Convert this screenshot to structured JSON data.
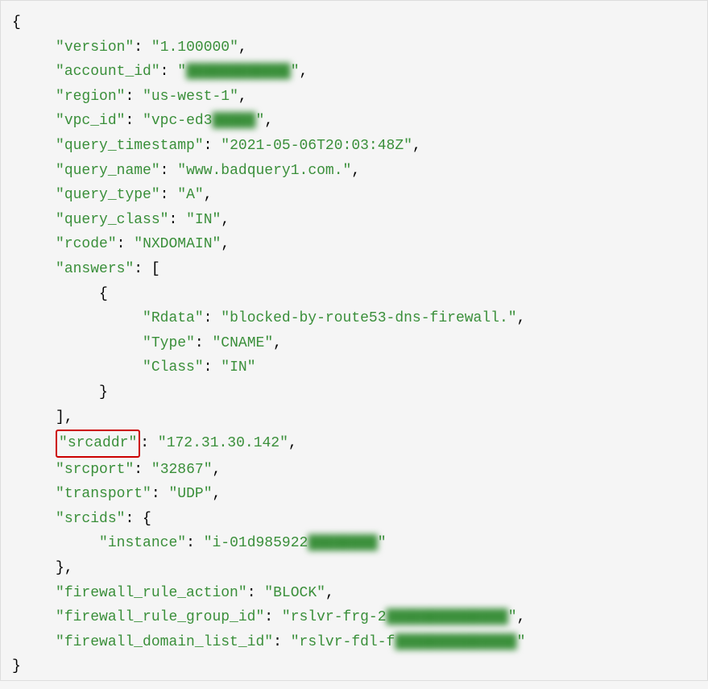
{
  "json_data": {
    "version": "1.100000",
    "account_id_prefix": "",
    "account_id_blurred": "████████████",
    "region": "us-west-1",
    "vpc_id_prefix": "vpc-ed3",
    "vpc_id_blurred": "█████",
    "query_timestamp": "2021-05-06T20:03:48Z",
    "query_name": "www.badquery1.com.",
    "query_type": "A",
    "query_class": "IN",
    "rcode": "NXDOMAIN",
    "answers": [
      {
        "Rdata": "blocked-by-route53-dns-firewall.",
        "Type": "CNAME",
        "Class": "IN"
      }
    ],
    "srcaddr": "172.31.30.142",
    "srcport": "32867",
    "transport": "UDP",
    "srcids": {
      "instance_prefix": "i-01d985922",
      "instance_blurred": "████████"
    },
    "firewall_rule_action": "BLOCK",
    "firewall_rule_group_id_prefix": "rslvr-frg-2",
    "firewall_rule_group_id_blurred": "██████████████",
    "firewall_domain_list_id_prefix": "rslvr-fdl-f",
    "firewall_domain_list_id_blurred": "██████████████"
  },
  "keys": {
    "version": "version",
    "account_id": "account_id",
    "region": "region",
    "vpc_id": "vpc_id",
    "query_timestamp": "query_timestamp",
    "query_name": "query_name",
    "query_type": "query_type",
    "query_class": "query_class",
    "rcode": "rcode",
    "answers": "answers",
    "Rdata": "Rdata",
    "Type": "Type",
    "Class": "Class",
    "srcaddr": "srcaddr",
    "srcport": "srcport",
    "transport": "transport",
    "srcids": "srcids",
    "instance": "instance",
    "firewall_rule_action": "firewall_rule_action",
    "firewall_rule_group_id": "firewall_rule_group_id",
    "firewall_domain_list_id": "firewall_domain_list_id"
  },
  "highlighted_key": "srcaddr"
}
